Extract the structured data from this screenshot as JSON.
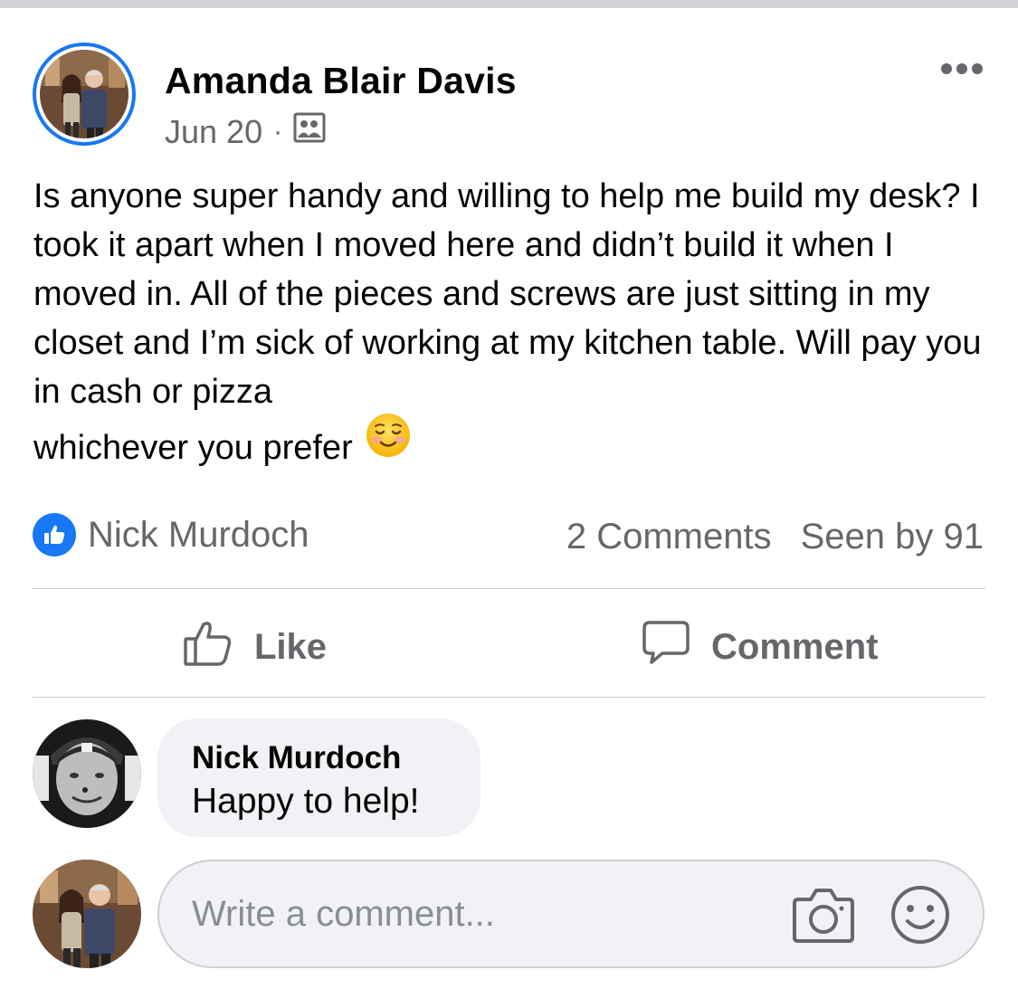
{
  "post": {
    "author": "Amanda Blair Davis",
    "date": "Jun 20",
    "separator": "·",
    "audience_icon": "group-icon",
    "text_main": "Is anyone super handy and willing to help me build my desk? I took it apart when I moved here and didn’t build it when I moved in. All of the pieces and screws are just sitting in my closet and I’m sick of working at my kitchen table. Will pay you in cash or pizza",
    "text_last": "whichever you prefer",
    "emoji": "smiling-face-emoji",
    "menu_icon": "more-options-icon"
  },
  "reactions": {
    "icon": "like-badge-icon",
    "reactor": "Nick Murdoch",
    "comments_count": "2 Comments",
    "seen_by": "Seen by 91"
  },
  "actions": {
    "like_label": "Like",
    "comment_label": "Comment"
  },
  "comments": [
    {
      "author": "Nick Murdoch",
      "text": "Happy to help!"
    }
  ],
  "composer": {
    "placeholder": "Write a comment...",
    "camera_icon": "camera-icon",
    "emoji_icon": "smiley-icon"
  },
  "colors": {
    "brand": "#1877f2",
    "secondary_text": "#65676b",
    "bubble_bg": "#f0f2f5",
    "divider": "#ced0d4"
  }
}
